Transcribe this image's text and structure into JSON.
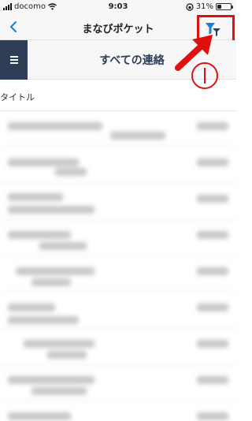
{
  "status_bar": {
    "carrier": "docomo",
    "time": "9:03",
    "battery": "31%",
    "battery_level": 0.31
  },
  "nav": {
    "title": "まなびポケット"
  },
  "section": {
    "title": "すべての連絡"
  },
  "list": {
    "column_header": "タイトル",
    "row_count": 8
  },
  "annotation": {
    "color": "#e01010"
  },
  "colors": {
    "accent": "#1a7fd6",
    "menu_bg": "#2f3d56",
    "title_text": "#2f3d56"
  },
  "icons": [
    "back-icon",
    "filter-icon",
    "menu-icon",
    "wifi-icon",
    "lock-rotation-icon",
    "battery-icon"
  ]
}
